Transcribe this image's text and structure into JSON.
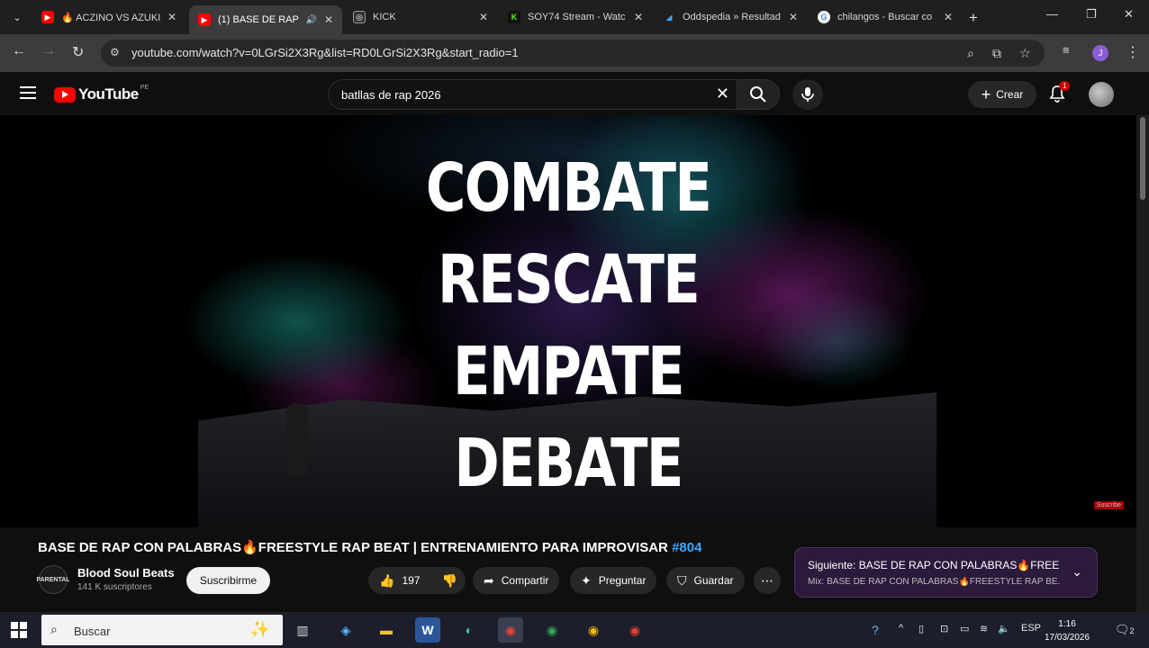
{
  "browser": {
    "tabs": [
      {
        "label": "🔥 ACZINO VS AZUKI",
        "favicon": "youtube",
        "active": false
      },
      {
        "label": "(1) BASE DE RAP",
        "favicon": "youtube",
        "active": true
      },
      {
        "label": "KICK",
        "favicon": "kick",
        "active": false
      },
      {
        "label": "SOY74 Stream - Watc",
        "favicon": "k-green",
        "active": false
      },
      {
        "label": "Oddspedia » Resultad",
        "favicon": "oddspedia",
        "active": false
      },
      {
        "label": "chilangos - Buscar co",
        "favicon": "google",
        "active": false
      }
    ],
    "url": "youtube.com/watch?v=0LGrSi2X3Rg&list=RD0LGrSi2X3Rg&start_radio=1",
    "profile_initial": "J"
  },
  "youtube": {
    "logo_text": "YouTube",
    "country": "PE",
    "search_query": "batllas de rap 2026",
    "create_label": "Crear",
    "notifications": "1"
  },
  "video": {
    "overlay_words": [
      "COMBATE",
      "RESCATE",
      "EMPATE",
      "DEBATE"
    ],
    "watermark": "Suscribe",
    "title": "BASE DE RAP CON PALABRAS🔥FREESTYLE RAP BEAT | ENTRENAMIENTO PARA IMPROVISAR",
    "hashtag": "#804",
    "channel": {
      "name": "Blood Soul Beats",
      "subs": "141 K suscriptores",
      "avatar_text": "PARENTAL"
    },
    "subscribe_label": "Suscribirme",
    "likes": "197",
    "share_label": "Compartir",
    "ask_label": "Preguntar",
    "save_label": "Guardar"
  },
  "next_up": {
    "line1": "Siguiente: BASE DE RAP CON PALABRAS🔥FREES...",
    "line2": "Mix: BASE DE RAP CON PALABRAS🔥FREESTYLE RAP BE..."
  },
  "taskbar": {
    "search_placeholder": "Buscar",
    "lang": "ESP",
    "time": "1:16",
    "date": "17/03/2026",
    "notif_count": "2"
  }
}
